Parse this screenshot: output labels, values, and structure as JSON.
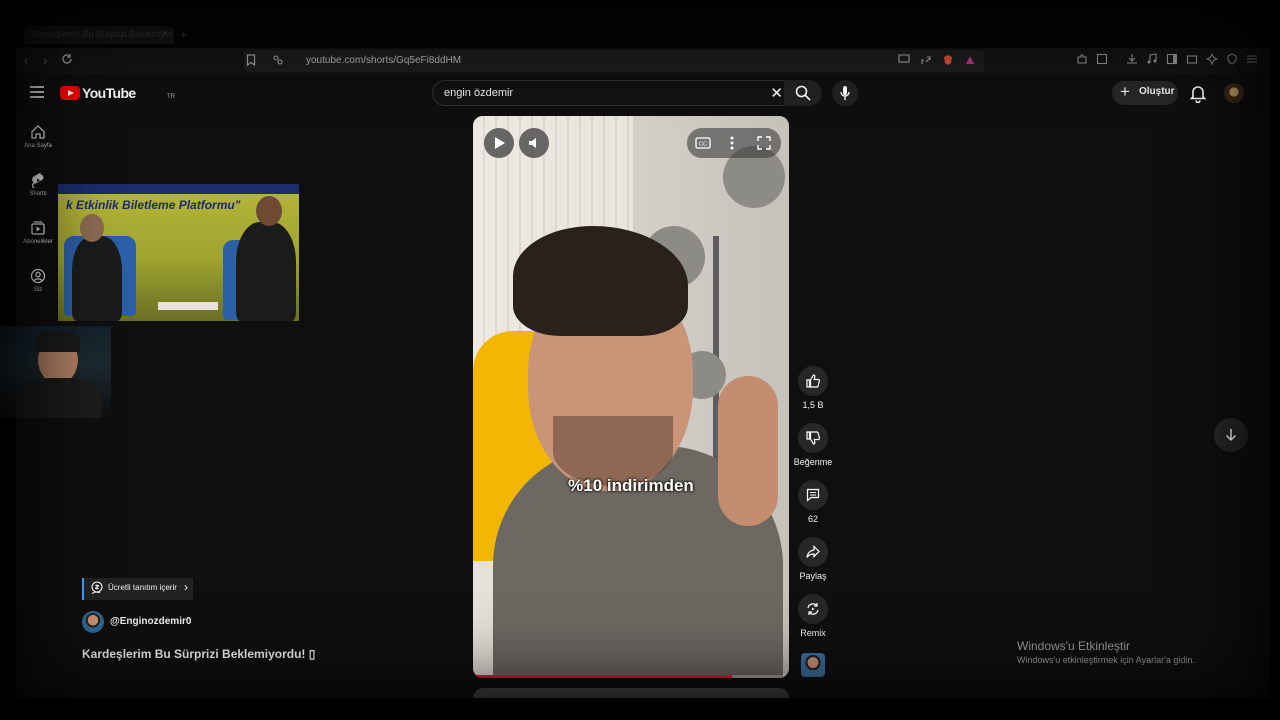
{
  "browser": {
    "tab_title": "Kardeşlerim Bu Sürprizi Beklemiyordu",
    "tab_close": "×",
    "new_tab": "+",
    "back": "‹",
    "forward": "›",
    "url": "youtube.com/shorts/Gq5eFi8ddHM"
  },
  "header": {
    "logo_text": "YouTube",
    "country": "TR",
    "search_value": "engin özdemir",
    "clear": "✕",
    "create_label": "Oluştur",
    "create_plus": "+"
  },
  "sidebar": {
    "items": [
      {
        "label": "Ana Sayfa",
        "icon": "home-icon"
      },
      {
        "label": "Shorts",
        "icon": "shorts-icon"
      },
      {
        "label": "Abonelikler",
        "icon": "subscriptions-icon"
      },
      {
        "label": "Siz",
        "icon": "you-icon"
      }
    ]
  },
  "overlay": {
    "pip_text": "k Etkinlik Biletleme Platformu\""
  },
  "player": {
    "caption": "%10 indirimden",
    "progress": 0.82
  },
  "actions": {
    "like_count": "1,5 B",
    "dislike_label": "Beğenme",
    "comment_count": "62",
    "share_label": "Paylaş",
    "remix_label": "Remix"
  },
  "meta": {
    "paid_badge": "Ücretli tanıtım içerir",
    "paid_chevron": "›",
    "channel": "@Enginozdemir0",
    "title": "Kardeşlerim Bu Sürprizi Beklemiyordu! ▯"
  },
  "windows": {
    "title": "Windows'u Etkinleştir",
    "subtitle": "Windows'u etkinleştirmek için Ayarlar'a gidin."
  },
  "colors": {
    "accent_red": "#ff0000",
    "progress_red": "#ff0033",
    "badge_blue": "#3ea6ff"
  }
}
